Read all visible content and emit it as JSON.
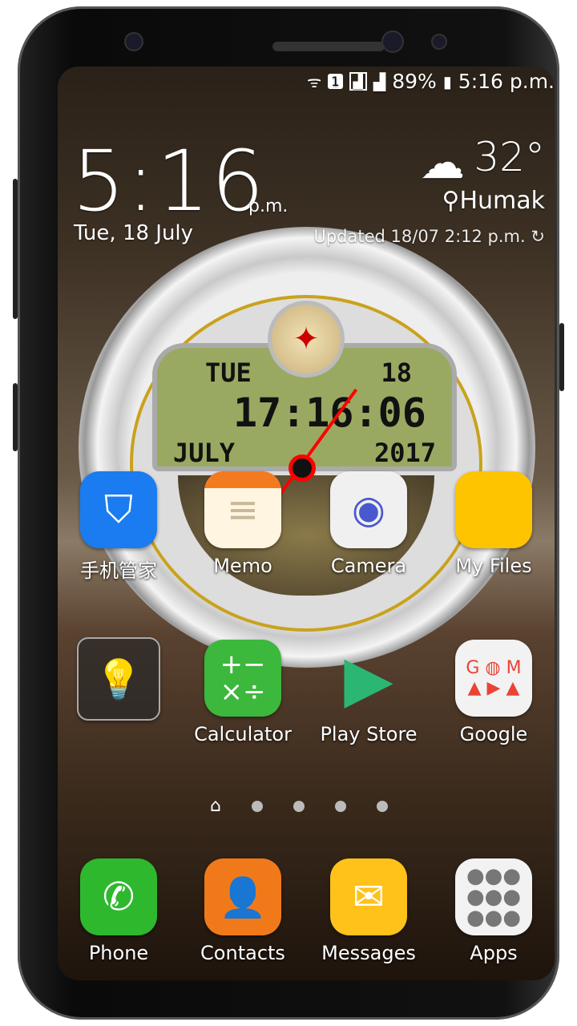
{
  "status_bar": {
    "icons": [
      "wifi-icon",
      "sim-1-icon",
      "signal-icon",
      "signal-icon"
    ],
    "battery": "89%",
    "time": "5:16 p.m."
  },
  "clock_widget": {
    "time": "5:16",
    "ampm": "p.m.",
    "date": "Tue, 18 July"
  },
  "weather": {
    "temperature": "32°",
    "icon": "thunderstorm-icon",
    "location": "Humak",
    "updated": "Updated 18/07 2:12 p.m."
  },
  "analog_clock": {
    "day": "TUE",
    "day_num": "18",
    "digital_time": "17:16:06",
    "month": "JULY",
    "year": "2017"
  },
  "apps": [
    {
      "label": "手机管家",
      "icon": "shield-icon",
      "color": "#1a7cf0"
    },
    {
      "label": "Memo",
      "icon": "notepad-icon",
      "color": "#fff5e0"
    },
    {
      "label": "Camera",
      "icon": "camera-icon",
      "color": "#f0f0f0"
    },
    {
      "label": "My Files",
      "icon": "folder-icon",
      "color": "#ffc400"
    },
    {
      "label": "",
      "icon": "flashlight-icon",
      "color": "#333"
    },
    {
      "label": "Calculator",
      "icon": "calculator-icon",
      "color": "#3cb83c"
    },
    {
      "label": "Play Store",
      "icon": "play-store-icon",
      "color": "transparent"
    },
    {
      "label": "Google",
      "icon": "google-folder-icon",
      "color": "#f2f2f2"
    }
  ],
  "pages": {
    "count": 5,
    "current": 0
  },
  "dock": [
    {
      "label": "Phone",
      "icon": "phone-icon",
      "color": "#2eb82e"
    },
    {
      "label": "Contacts",
      "icon": "contacts-icon",
      "color": "#f07a1a"
    },
    {
      "label": "Messages",
      "icon": "messages-icon",
      "color": "#ffc21a"
    },
    {
      "label": "Apps",
      "icon": "apps-grid-icon",
      "color": "#f2f2f2"
    }
  ]
}
